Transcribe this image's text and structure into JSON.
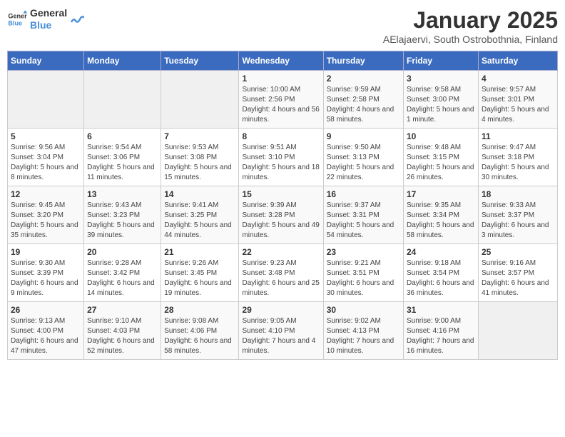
{
  "logo": {
    "text_general": "General",
    "text_blue": "Blue"
  },
  "title": "January 2025",
  "subtitle": "AElajaervi, South Ostrobothnia, Finland",
  "days_of_week": [
    "Sunday",
    "Monday",
    "Tuesday",
    "Wednesday",
    "Thursday",
    "Friday",
    "Saturday"
  ],
  "weeks": [
    [
      {
        "day": "",
        "info": ""
      },
      {
        "day": "",
        "info": ""
      },
      {
        "day": "",
        "info": ""
      },
      {
        "day": "1",
        "info": "Sunrise: 10:00 AM\nSunset: 2:56 PM\nDaylight: 4 hours and 56 minutes."
      },
      {
        "day": "2",
        "info": "Sunrise: 9:59 AM\nSunset: 2:58 PM\nDaylight: 4 hours and 58 minutes."
      },
      {
        "day": "3",
        "info": "Sunrise: 9:58 AM\nSunset: 3:00 PM\nDaylight: 5 hours and 1 minute."
      },
      {
        "day": "4",
        "info": "Sunrise: 9:57 AM\nSunset: 3:01 PM\nDaylight: 5 hours and 4 minutes."
      }
    ],
    [
      {
        "day": "5",
        "info": "Sunrise: 9:56 AM\nSunset: 3:04 PM\nDaylight: 5 hours and 8 minutes."
      },
      {
        "day": "6",
        "info": "Sunrise: 9:54 AM\nSunset: 3:06 PM\nDaylight: 5 hours and 11 minutes."
      },
      {
        "day": "7",
        "info": "Sunrise: 9:53 AM\nSunset: 3:08 PM\nDaylight: 5 hours and 15 minutes."
      },
      {
        "day": "8",
        "info": "Sunrise: 9:51 AM\nSunset: 3:10 PM\nDaylight: 5 hours and 18 minutes."
      },
      {
        "day": "9",
        "info": "Sunrise: 9:50 AM\nSunset: 3:13 PM\nDaylight: 5 hours and 22 minutes."
      },
      {
        "day": "10",
        "info": "Sunrise: 9:48 AM\nSunset: 3:15 PM\nDaylight: 5 hours and 26 minutes."
      },
      {
        "day": "11",
        "info": "Sunrise: 9:47 AM\nSunset: 3:18 PM\nDaylight: 5 hours and 30 minutes."
      }
    ],
    [
      {
        "day": "12",
        "info": "Sunrise: 9:45 AM\nSunset: 3:20 PM\nDaylight: 5 hours and 35 minutes."
      },
      {
        "day": "13",
        "info": "Sunrise: 9:43 AM\nSunset: 3:23 PM\nDaylight: 5 hours and 39 minutes."
      },
      {
        "day": "14",
        "info": "Sunrise: 9:41 AM\nSunset: 3:25 PM\nDaylight: 5 hours and 44 minutes."
      },
      {
        "day": "15",
        "info": "Sunrise: 9:39 AM\nSunset: 3:28 PM\nDaylight: 5 hours and 49 minutes."
      },
      {
        "day": "16",
        "info": "Sunrise: 9:37 AM\nSunset: 3:31 PM\nDaylight: 5 hours and 54 minutes."
      },
      {
        "day": "17",
        "info": "Sunrise: 9:35 AM\nSunset: 3:34 PM\nDaylight: 5 hours and 58 minutes."
      },
      {
        "day": "18",
        "info": "Sunrise: 9:33 AM\nSunset: 3:37 PM\nDaylight: 6 hours and 3 minutes."
      }
    ],
    [
      {
        "day": "19",
        "info": "Sunrise: 9:30 AM\nSunset: 3:39 PM\nDaylight: 6 hours and 9 minutes."
      },
      {
        "day": "20",
        "info": "Sunrise: 9:28 AM\nSunset: 3:42 PM\nDaylight: 6 hours and 14 minutes."
      },
      {
        "day": "21",
        "info": "Sunrise: 9:26 AM\nSunset: 3:45 PM\nDaylight: 6 hours and 19 minutes."
      },
      {
        "day": "22",
        "info": "Sunrise: 9:23 AM\nSunset: 3:48 PM\nDaylight: 6 hours and 25 minutes."
      },
      {
        "day": "23",
        "info": "Sunrise: 9:21 AM\nSunset: 3:51 PM\nDaylight: 6 hours and 30 minutes."
      },
      {
        "day": "24",
        "info": "Sunrise: 9:18 AM\nSunset: 3:54 PM\nDaylight: 6 hours and 36 minutes."
      },
      {
        "day": "25",
        "info": "Sunrise: 9:16 AM\nSunset: 3:57 PM\nDaylight: 6 hours and 41 minutes."
      }
    ],
    [
      {
        "day": "26",
        "info": "Sunrise: 9:13 AM\nSunset: 4:00 PM\nDaylight: 6 hours and 47 minutes."
      },
      {
        "day": "27",
        "info": "Sunrise: 9:10 AM\nSunset: 4:03 PM\nDaylight: 6 hours and 52 minutes."
      },
      {
        "day": "28",
        "info": "Sunrise: 9:08 AM\nSunset: 4:06 PM\nDaylight: 6 hours and 58 minutes."
      },
      {
        "day": "29",
        "info": "Sunrise: 9:05 AM\nSunset: 4:10 PM\nDaylight: 7 hours and 4 minutes."
      },
      {
        "day": "30",
        "info": "Sunrise: 9:02 AM\nSunset: 4:13 PM\nDaylight: 7 hours and 10 minutes."
      },
      {
        "day": "31",
        "info": "Sunrise: 9:00 AM\nSunset: 4:16 PM\nDaylight: 7 hours and 16 minutes."
      },
      {
        "day": "",
        "info": ""
      }
    ]
  ]
}
